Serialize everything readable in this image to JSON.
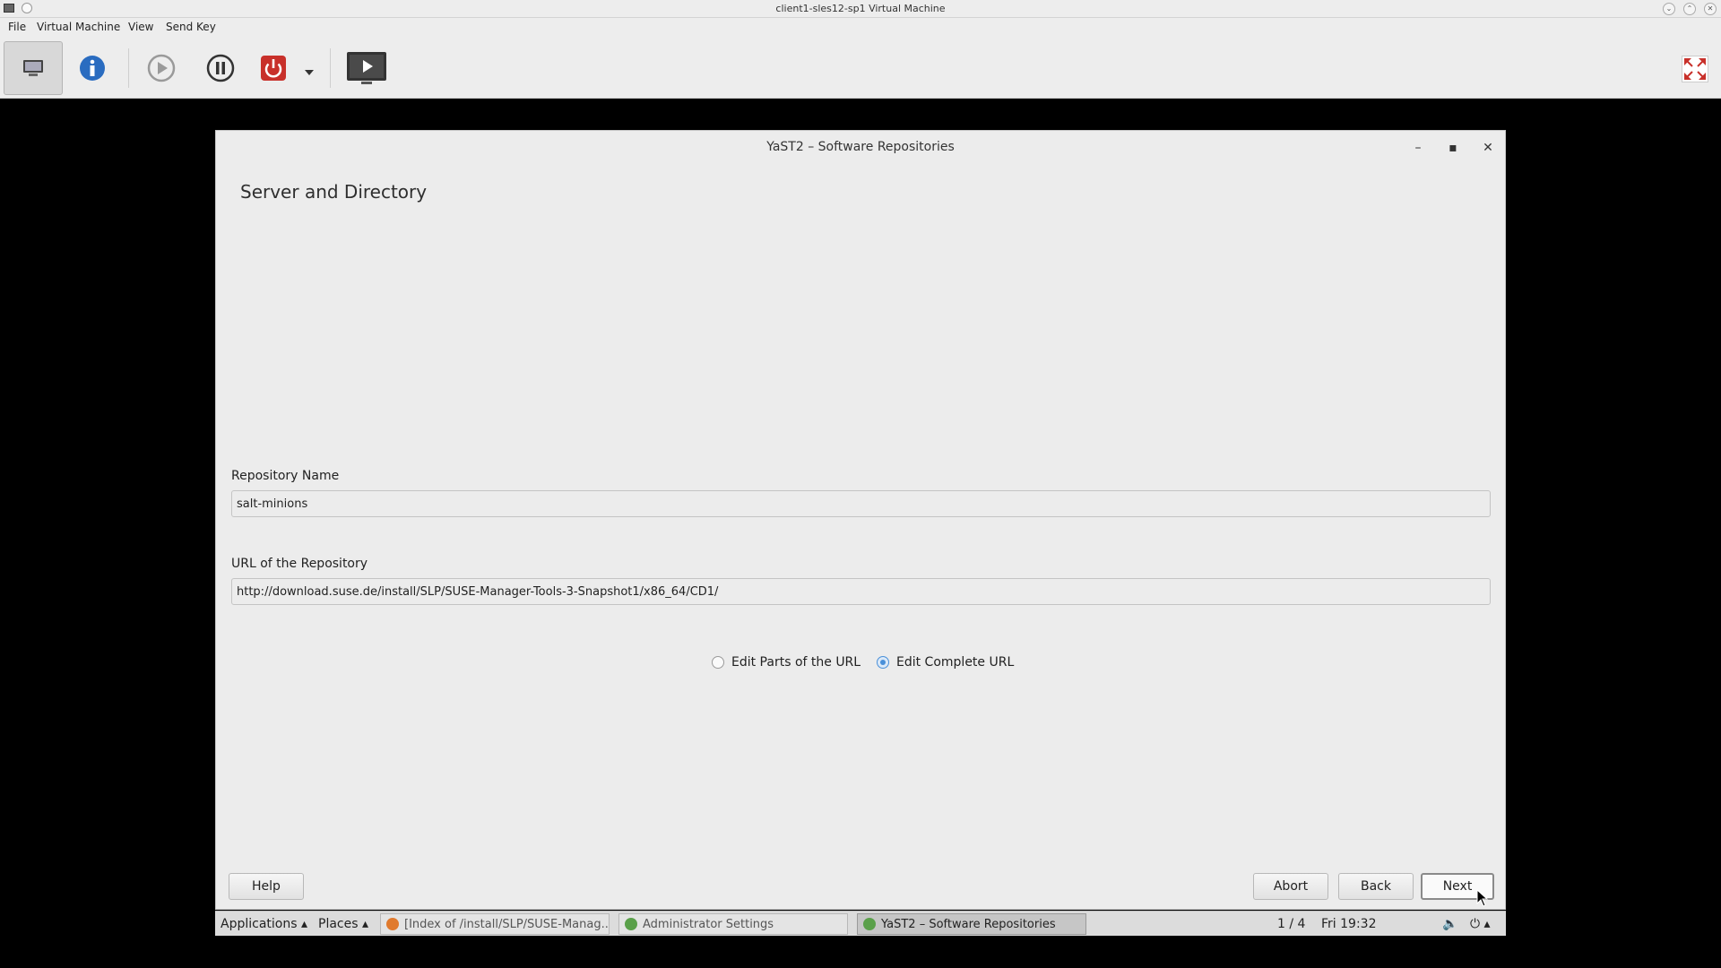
{
  "host": {
    "title": "client1-sles12-sp1 Virtual Machine",
    "menu": [
      "File",
      "Virtual Machine",
      "View",
      "Send Key"
    ],
    "toolbar": {
      "console": "monitor-icon",
      "details": "info-icon",
      "run": "play-icon",
      "pause": "pause-icon",
      "shutdown": "power-icon",
      "shutdown_menu": "chevron-down-icon",
      "screenshot": "display-icon",
      "fullscreen": "fullscreen-icon"
    }
  },
  "yast": {
    "title": "YaST2 – Software Repositories",
    "heading": "Server and Directory",
    "repo_name_label": "Repository Name",
    "repo_name_value": "salt-minions",
    "radio_parts_label": "Edit Parts of the URL",
    "radio_complete_label": "Edit Complete URL",
    "radio_selected": "complete",
    "url_label": "URL of the Repository",
    "url_value": "http://download.suse.de/install/SLP/SUSE-Manager-Tools-3-Snapshot1/x86_64/CD1/",
    "buttons": {
      "help": "Help",
      "abort": "Abort",
      "back": "Back",
      "next": "Next"
    }
  },
  "taskbar": {
    "applications": "Applications ▴",
    "places": "Places ▴",
    "tasks": [
      "[Index of /install/SLP/SUSE-Manag...",
      "Administrator Settings",
      "YaST2 – Software Repositories"
    ],
    "workspace": "1 / 4",
    "clock": "Fri 19:32"
  },
  "colors": {
    "accent": "#4a90d9",
    "power_red": "#c8302a",
    "info_blue": "#2a6cc0"
  }
}
